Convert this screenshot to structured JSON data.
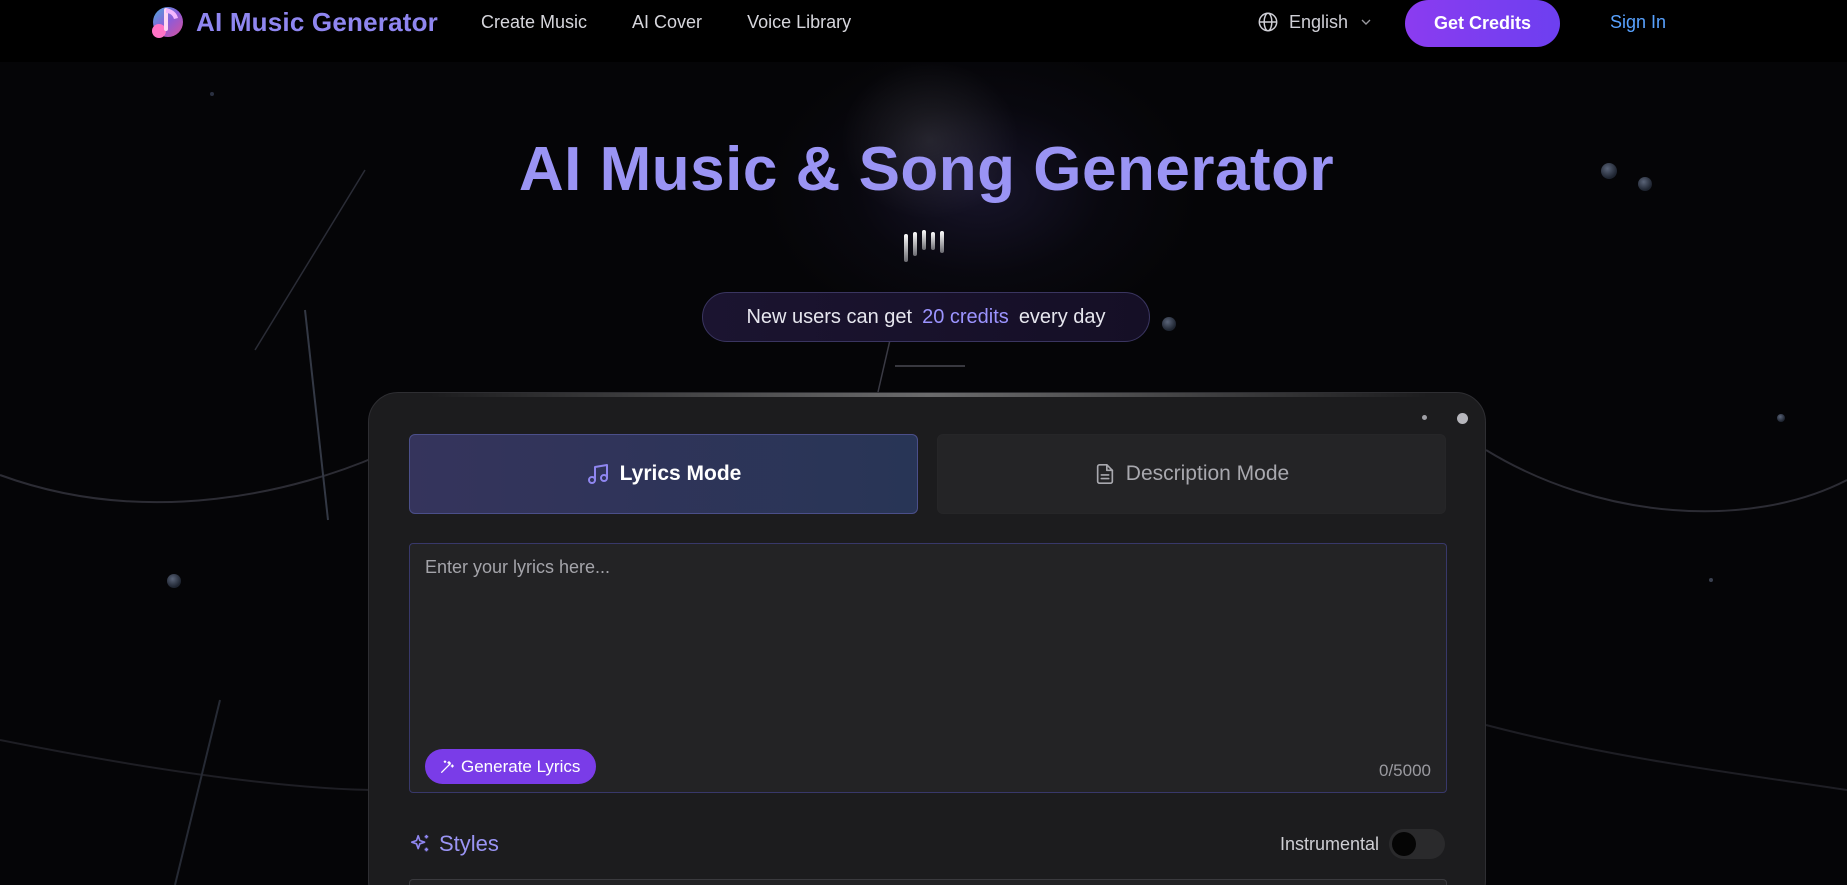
{
  "nav": {
    "brand": "AI Music Generator",
    "links": [
      "Create Music",
      "AI Cover",
      "Voice Library"
    ],
    "language": "English",
    "cta": "Get Credits",
    "signin": "Sign In"
  },
  "hero": {
    "title": "AI Music & Song Generator",
    "pill_prefix": "New users can get",
    "pill_highlight": "20 credits",
    "pill_suffix": "every day"
  },
  "modes": {
    "lyrics": "Lyrics Mode",
    "description": "Description Mode",
    "active": "lyrics"
  },
  "lyrics": {
    "placeholder": "Enter your lyrics here...",
    "generate_label": "Generate Lyrics",
    "counter": "0/5000"
  },
  "styles": {
    "label": "Styles",
    "instrumental_label": "Instrumental",
    "instrumental_on": false
  },
  "colors": {
    "accent": "#9a94f4",
    "button": "#7a3ce8",
    "link": "#58a2ff"
  }
}
